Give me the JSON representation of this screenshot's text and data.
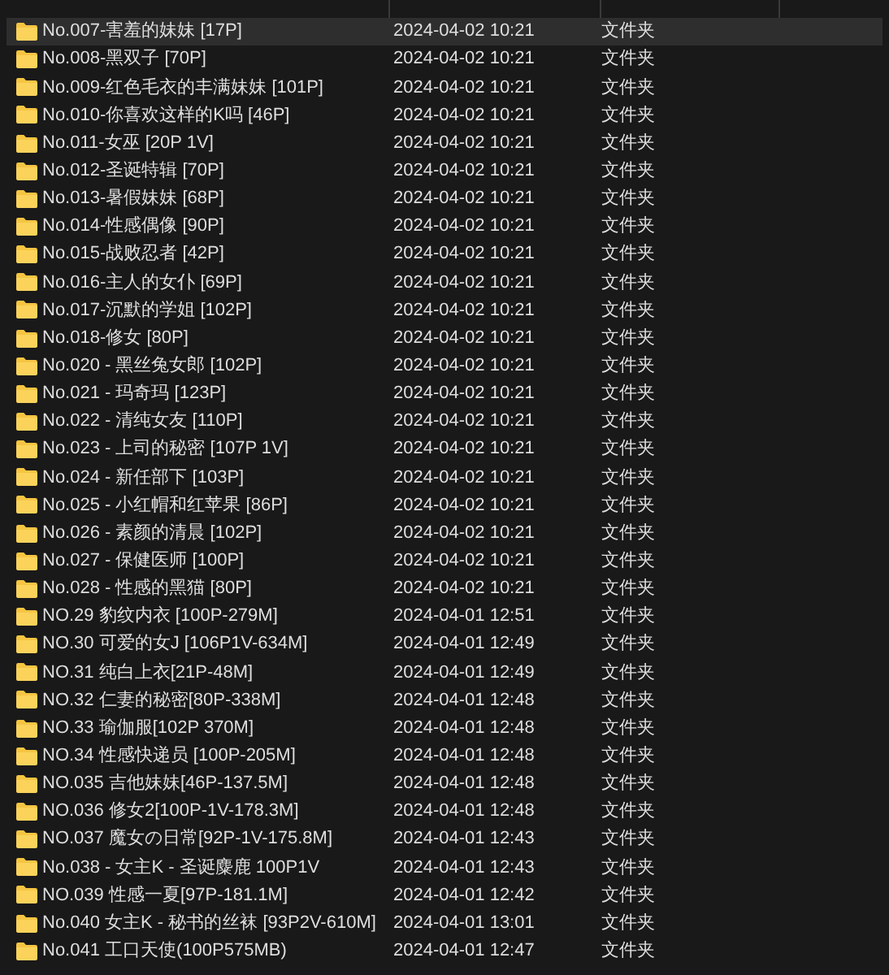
{
  "files": [
    {
      "name": "No.007-害羞的妹妹 [17P]",
      "modified": "2024-04-02 10:21",
      "type": "文件夹",
      "selected": true
    },
    {
      "name": "No.008-黑双子 [70P]",
      "modified": "2024-04-02 10:21",
      "type": "文件夹",
      "selected": false
    },
    {
      "name": "No.009-红色毛衣的丰满妹妹 [101P]",
      "modified": "2024-04-02 10:21",
      "type": "文件夹",
      "selected": false
    },
    {
      "name": "No.010-你喜欢这样的K吗 [46P]",
      "modified": "2024-04-02 10:21",
      "type": "文件夹",
      "selected": false
    },
    {
      "name": "No.011-女巫 [20P 1V]",
      "modified": "2024-04-02 10:21",
      "type": "文件夹",
      "selected": false
    },
    {
      "name": "No.012-圣诞特辑 [70P]",
      "modified": "2024-04-02 10:21",
      "type": "文件夹",
      "selected": false
    },
    {
      "name": "No.013-暑假妹妹 [68P]",
      "modified": "2024-04-02 10:21",
      "type": "文件夹",
      "selected": false
    },
    {
      "name": "No.014-性感偶像 [90P]",
      "modified": "2024-04-02 10:21",
      "type": "文件夹",
      "selected": false
    },
    {
      "name": "No.015-战败忍者 [42P]",
      "modified": "2024-04-02 10:21",
      "type": "文件夹",
      "selected": false
    },
    {
      "name": "No.016-主人的女仆 [69P]",
      "modified": "2024-04-02 10:21",
      "type": "文件夹",
      "selected": false
    },
    {
      "name": "No.017-沉默的学姐 [102P]",
      "modified": "2024-04-02 10:21",
      "type": "文件夹",
      "selected": false
    },
    {
      "name": "No.018-修女 [80P]",
      "modified": "2024-04-02 10:21",
      "type": "文件夹",
      "selected": false
    },
    {
      "name": "No.020 - 黑丝兔女郎 [102P]",
      "modified": "2024-04-02 10:21",
      "type": "文件夹",
      "selected": false
    },
    {
      "name": "No.021 - 玛奇玛 [123P]",
      "modified": "2024-04-02 10:21",
      "type": "文件夹",
      "selected": false
    },
    {
      "name": "No.022 - 清纯女友 [110P]",
      "modified": "2024-04-02 10:21",
      "type": "文件夹",
      "selected": false
    },
    {
      "name": "No.023 - 上司的秘密 [107P 1V]",
      "modified": "2024-04-02 10:21",
      "type": "文件夹",
      "selected": false
    },
    {
      "name": "No.024 - 新任部下 [103P]",
      "modified": "2024-04-02 10:21",
      "type": "文件夹",
      "selected": false
    },
    {
      "name": "No.025 - 小红帽和红苹果 [86P]",
      "modified": "2024-04-02 10:21",
      "type": "文件夹",
      "selected": false
    },
    {
      "name": "No.026 - 素颜的清晨 [102P]",
      "modified": "2024-04-02 10:21",
      "type": "文件夹",
      "selected": false
    },
    {
      "name": "No.027 - 保健医师 [100P]",
      "modified": "2024-04-02 10:21",
      "type": "文件夹",
      "selected": false
    },
    {
      "name": "No.028 - 性感的黑猫 [80P]",
      "modified": "2024-04-02 10:21",
      "type": "文件夹",
      "selected": false
    },
    {
      "name": "NO.29 豹纹内衣 [100P-279M]",
      "modified": "2024-04-01 12:51",
      "type": "文件夹",
      "selected": false
    },
    {
      "name": "NO.30 可爱的女J [106P1V-634M]",
      "modified": "2024-04-01 12:49",
      "type": "文件夹",
      "selected": false
    },
    {
      "name": "NO.31 纯白上衣[21P-48M]",
      "modified": "2024-04-01 12:49",
      "type": "文件夹",
      "selected": false
    },
    {
      "name": "NO.32 仁妻的秘密[80P-338M]",
      "modified": "2024-04-01 12:48",
      "type": "文件夹",
      "selected": false
    },
    {
      "name": "NO.33 瑜伽服[102P 370M]",
      "modified": "2024-04-01 12:48",
      "type": "文件夹",
      "selected": false
    },
    {
      "name": "NO.34 性感快递员 [100P-205M]",
      "modified": "2024-04-01 12:48",
      "type": "文件夹",
      "selected": false
    },
    {
      "name": "NO.035 吉他妹妹[46P-137.5M]",
      "modified": "2024-04-01 12:48",
      "type": "文件夹",
      "selected": false
    },
    {
      "name": "NO.036 修女2[100P-1V-178.3M]",
      "modified": "2024-04-01 12:48",
      "type": "文件夹",
      "selected": false
    },
    {
      "name": "NO.037 魔女の日常[92P-1V-175.8M]",
      "modified": "2024-04-01 12:43",
      "type": "文件夹",
      "selected": false
    },
    {
      "name": "No.038 - 女主K - 圣诞麋鹿 100P1V",
      "modified": "2024-04-01 12:43",
      "type": "文件夹",
      "selected": false
    },
    {
      "name": "NO.039 性感一夏[97P-181.1M]",
      "modified": "2024-04-01 12:42",
      "type": "文件夹",
      "selected": false
    },
    {
      "name": "No.040 女主K - 秘书的丝袜 [93P2V-610M]",
      "modified": "2024-04-01 13:01",
      "type": "文件夹",
      "selected": false
    },
    {
      "name": "No.041 工口天使(100P575MB)",
      "modified": "2024-04-01 12:47",
      "type": "文件夹",
      "selected": false
    }
  ]
}
